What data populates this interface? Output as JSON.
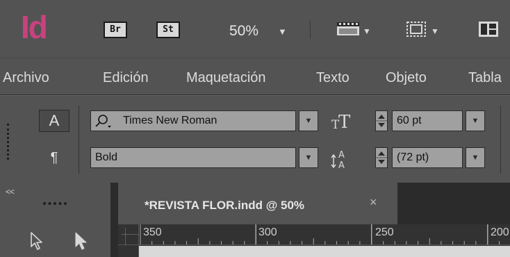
{
  "app": {
    "logo": "Id",
    "bridge_label": "Br",
    "stock_label": "St",
    "zoom": "50%",
    "dropdown_caret": "▼"
  },
  "menu": {
    "items": [
      "Archivo",
      "Edición",
      "Maquetación",
      "Texto",
      "Objeto",
      "Tabla"
    ]
  },
  "control_panel": {
    "character_mode": "A",
    "paragraph_mode": "¶",
    "font_family": "Times New Roman",
    "font_style": "Bold",
    "font_size": "60 pt",
    "leading": "(72 pt)"
  },
  "tools": {
    "collapse": "<<"
  },
  "document": {
    "tab_title": "*REVISTA FLOR.indd @ 50%",
    "close": "×"
  },
  "ruler": {
    "labels": [
      "350",
      "300",
      "250",
      "200"
    ]
  },
  "colors": {
    "chrome": "#535353",
    "dark": "#323232",
    "logo": "#c8427f",
    "field": "#a0a0a0"
  }
}
